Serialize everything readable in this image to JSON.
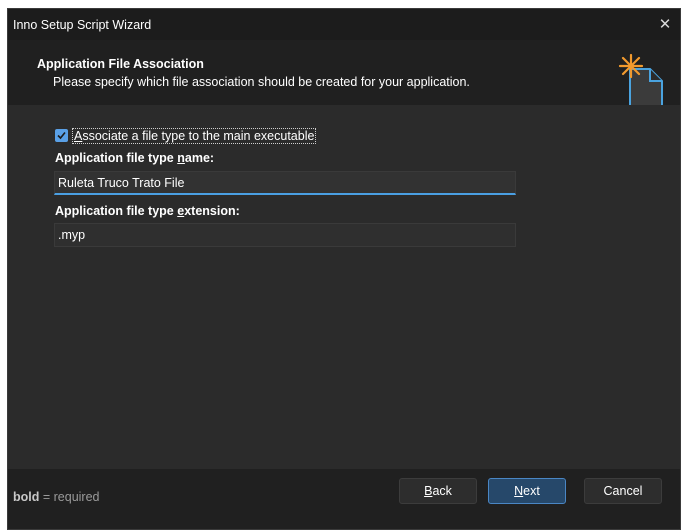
{
  "window": {
    "title": "Inno Setup Script Wizard"
  },
  "header": {
    "title": "Application File Association",
    "subtitle": "Please specify which file association should be created for your application."
  },
  "form": {
    "associate_checkbox": {
      "checked": true,
      "label_first": "A",
      "label_rest": "ssociate a file type to the main executable"
    },
    "type_name_label": {
      "before": "Application file type ",
      "underlined": "n",
      "after": "ame:"
    },
    "type_name_value": "Ruleta Truco Trato File",
    "extension_label": {
      "before": "Application file type ",
      "underlined": "e",
      "after": "xtension:"
    },
    "extension_value": ".myp"
  },
  "footer": {
    "note_bold": "bold",
    "note_rest": " = required",
    "back": {
      "underlined": "B",
      "rest": "ack"
    },
    "next": {
      "underlined": "N",
      "rest": "ext"
    },
    "cancel": "Cancel"
  },
  "colors": {
    "accent": "#4a9fe3",
    "background": "#2b2b2b",
    "header": "#202020"
  },
  "icons": [
    "close-icon",
    "wizard-document-icon",
    "checkmark-icon"
  ]
}
